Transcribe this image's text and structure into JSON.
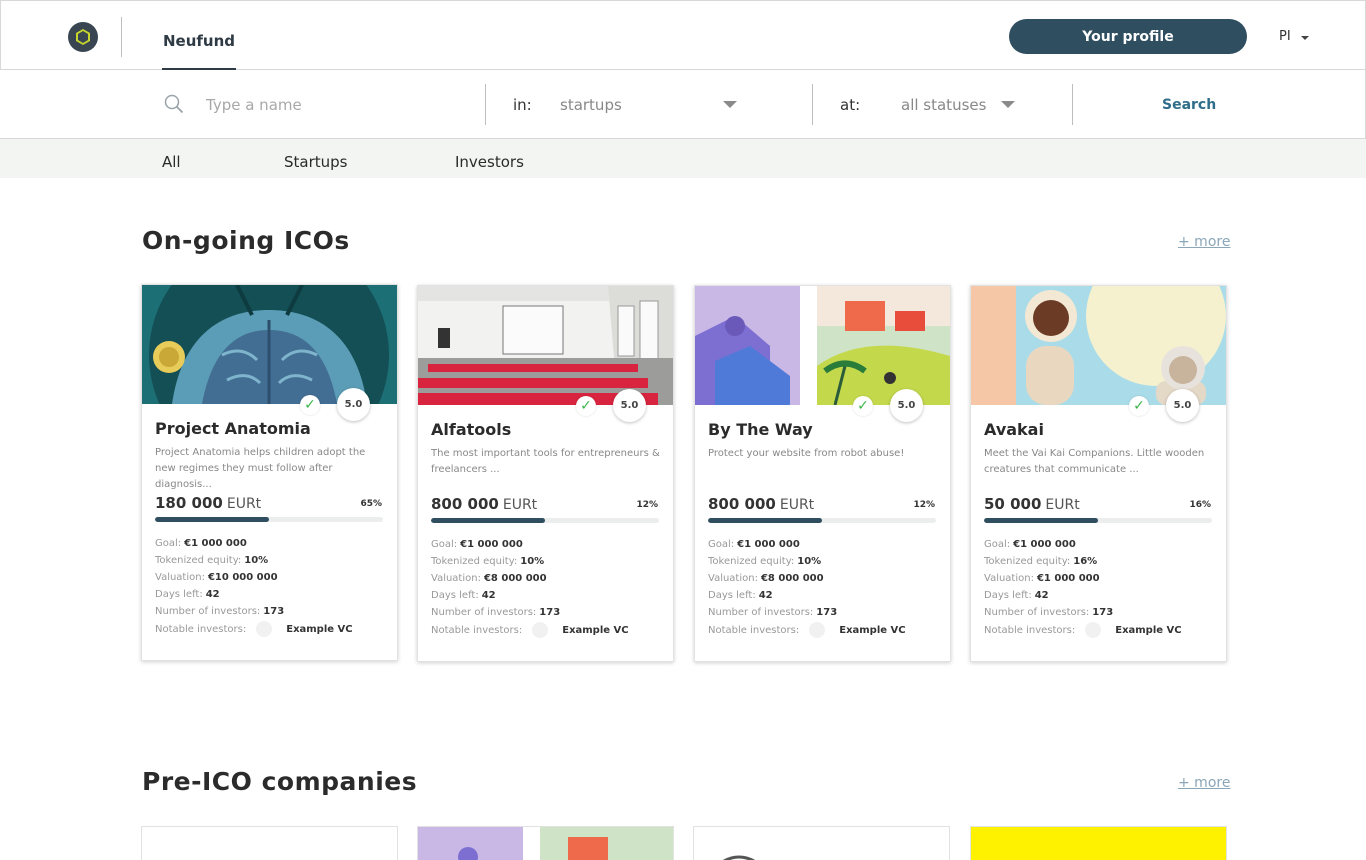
{
  "header": {
    "brand": "Neufund",
    "profile_button": "Your profile",
    "language": "PI"
  },
  "search": {
    "placeholder": "Type a name",
    "in_label": "in:",
    "in_value": "startups",
    "at_label": "at:",
    "at_value": "all statuses",
    "button": "Search"
  },
  "tabs": [
    "All",
    "Startups",
    "Investors"
  ],
  "sections": {
    "ongoing": {
      "title": "On-going ICOs",
      "more": "+ more"
    },
    "preico": {
      "title": "Pre-ICO companies",
      "more": "+ more"
    }
  },
  "labels": {
    "goal": "Goal:",
    "tokenized": "Tokenized equity:",
    "valuation": "Valuation:",
    "days": "Days left:",
    "investors": "Number of investors:",
    "notable": "Notable investors:"
  },
  "cards": [
    {
      "name": "Project Anatomia",
      "desc": "Project Anatomia helps children adopt the new regimes they must follow after diagnosis...",
      "rating": "5.0",
      "check": "✓",
      "amount": "180 000",
      "currency": "EURt",
      "percent": "65%",
      "progress": 0.5,
      "goal": "€1 000 000",
      "tokenized": "10%",
      "valuation": "€10 000 000",
      "days": "42",
      "investors": "173",
      "notable": "Example VC"
    },
    {
      "name": "Alfatools",
      "desc": "The most important tools for entrepreneurs & freelancers ...",
      "rating": "5.0",
      "check": "✓",
      "amount": "800 000",
      "currency": "EURt",
      "percent": "12%",
      "progress": 0.5,
      "goal": "€1 000 000",
      "tokenized": "10%",
      "valuation": "€8 000 000",
      "days": "42",
      "investors": "173",
      "notable": "Example VC"
    },
    {
      "name": "By The Way",
      "desc": "Protect your website from robot abuse!",
      "rating": "5.0",
      "check": "✓",
      "amount": "800 000",
      "currency": "EURt",
      "percent": "12%",
      "progress": 0.5,
      "goal": "€1 000 000",
      "tokenized": "10%",
      "valuation": "€8 000 000",
      "days": "42",
      "investors": "173",
      "notable": "Example VC"
    },
    {
      "name": "Avakai",
      "desc": "Meet the Vai Kai Companions.  Little wooden creatures that communicate ...",
      "rating": "5.0",
      "check": "✓",
      "amount": "50 000",
      "currency": "EURt",
      "percent": "16%",
      "progress": 0.5,
      "goal": "€1 000 000",
      "tokenized": "16%",
      "valuation": "€1 000 000",
      "days": "42",
      "investors": "173",
      "notable": "Example VC"
    }
  ],
  "colors": {
    "primary": "#2f4e60",
    "accent_link": "#2f6d8a",
    "check_green": "#3bb54a"
  }
}
